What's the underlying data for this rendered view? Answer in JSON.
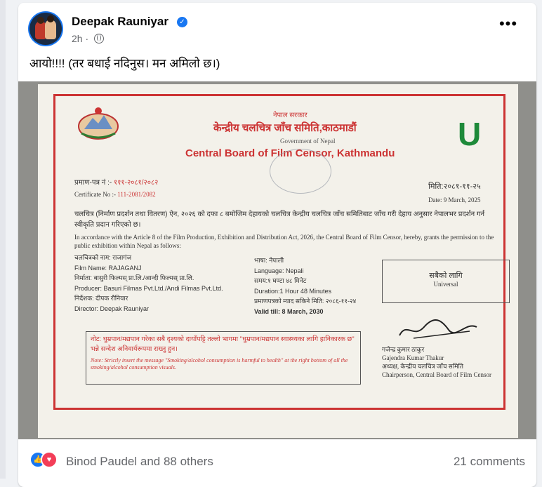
{
  "post": {
    "author": "Deepak Rauniyar",
    "time": "2h",
    "separator": "·",
    "caption": "आयो!!!! (तर बधाई नदिनुस। मन अमिलो छ।)"
  },
  "certificate": {
    "gov_np": "नेपाल सरकार",
    "board_np": "केन्द्रीय चलचित्र जाँच समिति,काठमाडौं",
    "gov_en": "Government of Nepal",
    "board_en": "Central Board of Film Censor, Kathmandu",
    "rating": "U",
    "cert_no_np_label": "प्रमाण-पत्र नं :-",
    "cert_no_np_value": "१११-२०८१/२०८२",
    "cert_no_en_label": "Certificate No :-",
    "cert_no_en_value": "111-2081/2082",
    "date_np": "मिति:२०८१-११-२५",
    "date_en": "Date: 9 March, 2025",
    "body_np": "चलचित्र (निर्माण प्रदर्शन तथा वितरण) ऐन, २०२६ को दफा ८ बमोजिम देहायको चलचित्र केन्द्रीय चलचित्र जाँच समितिबाट जाँच गरी देहाय अनुसार नेपालभर प्रदर्शन गर्न स्वीकृति प्रदान गरिएको छ।",
    "body_en": "In accordance with the Article 8 of the Film Production, Exhibition and Distribution Act, 2026, the Central Board of Film Censor, hereby, grants the permission to the public exhibition within Nepal as follows:",
    "film_name_np": "चलचित्रको नाम: राजागंज",
    "film_name_en": "Film Name: RAJAGANJ",
    "producer_np": "निर्माता: बासुरी फिल्मस् प्रा.लि./आन्दी फिल्मस् प्रा.लि.",
    "producer_en": "Producer: Basuri Filmas Pvt.Ltd./Andi Filmas Pvt.Ltd.",
    "director_np": "निर्देशक: दीपक रौनियार",
    "director_en": "Director: Deepak Rauniyar",
    "language_np": "भाषा: नेपाली",
    "language_en": "Language: Nepali",
    "duration_np": "समय:१ घण्टा ४८ मिनेट",
    "duration_en": "Duration:1 Hour 48 Minutes",
    "validity_np": "प्रमाणपत्रको म्याद सकिने मिति: २०८६-११-२४",
    "validity_en": "Valid till: 8 March, 2030",
    "category_np": "सबैको लागि",
    "category_en": "Universal",
    "note_np": "नोट: धुम्रपान/मद्यपान गरेका सबै दृश्यको दायाँपट्टि तल्लो भागमा \"धुम्रपान/मद्यपान स्वास्थ्यका लागि हानिकारक छ\" भन्ने सन्देश अनिवार्यरूपमा राख्नु हुन।",
    "note_en": "Note: Strictly insert the message \"Smoking/alcohol consumption is harmful to health\" at the right bottom of all the smoking/alcohol consumption visuals.",
    "signer_np": "गजेन्द्र कुमार ठाकुर",
    "signer_en": "Gajendra Kumar Thakur",
    "signer_title_np": "अध्यक्ष, केन्द्रीय चलचित्र जाँच समिति",
    "signer_title_en": "Chairperson, Central Board of Film Censor"
  },
  "reactions": {
    "summary": "Binod Paudel and 88 others",
    "comments": "21 comments"
  }
}
